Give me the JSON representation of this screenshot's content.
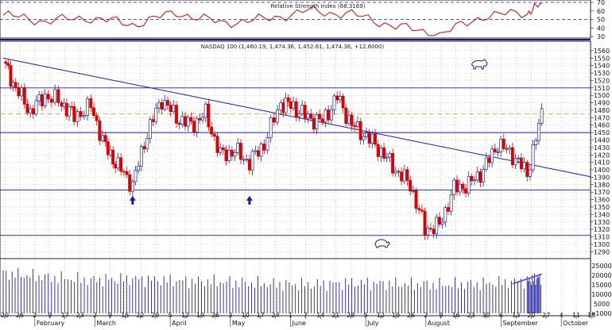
{
  "rsi_panel": {
    "title": "Relative Strength Index (68.3169)",
    "y_ticks": [
      "70",
      "60",
      "50",
      "40",
      "30"
    ]
  },
  "price_panel": {
    "title": "NASDAQ 100 (1,460.19, 1,474.36, 1,452.61, 1,474.36, +12.6000)",
    "y_ticks": [
      "1560",
      "1550",
      "1540",
      "1530",
      "1520",
      "1510",
      "1500",
      "1490",
      "1480",
      "1470",
      "1460",
      "1450",
      "1440",
      "1430",
      "1420",
      "1410",
      "1400",
      "1390",
      "1380",
      "1370",
      "1360",
      "1350",
      "1340",
      "1330",
      "1320",
      "1310",
      "1300",
      "1290"
    ]
  },
  "volume_panel": {
    "y_ticks": [
      "25000",
      "20000",
      "15000",
      "10000",
      "5000",
      "x1000"
    ]
  },
  "x_axis": {
    "day_ticks": [
      "20",
      "26",
      "2",
      "9",
      "17",
      "23",
      "2",
      "9",
      "15",
      "22",
      "29",
      "5",
      "12",
      "19",
      "26",
      "3",
      "10",
      "17",
      "24",
      "1",
      "7",
      "14",
      "21",
      "28",
      "5",
      "12",
      "19",
      "26",
      "2",
      "9",
      "16",
      "23",
      "30",
      "6",
      "13",
      "20",
      "27",
      "4",
      "11",
      "18"
    ],
    "month_labels": [
      "February",
      "March",
      "April",
      "May",
      "June",
      "July",
      "August",
      "September",
      "October"
    ]
  },
  "colors": {
    "up": "#1f2a8c",
    "down": "#e00000",
    "rsi_line": "#d80000",
    "trend_line": "#1a1aa8",
    "support_line": "#1a1aa8",
    "reference_dashed": "#f0a050",
    "volume": "#20209a",
    "grid": "#7a7a7a"
  },
  "icons": [
    "bull-icon",
    "bear-icon",
    "up-arrow-icon"
  ],
  "chart_data": [
    {
      "type": "line",
      "name": "Relative Strength Index",
      "ylim": [
        30,
        70
      ],
      "reference_levels": [
        50,
        70
      ],
      "last_value": 68.3169,
      "x": [
        "Jan 20",
        "Feb 9",
        "Mar 2",
        "Mar 22",
        "Apr 12",
        "May 3",
        "May 24",
        "Jun 14",
        "Jul 5",
        "Jul 26",
        "Aug 16",
        "Sep 6",
        "Sep 27",
        "Oct 4"
      ],
      "values": [
        55,
        48,
        52,
        44,
        58,
        46,
        50,
        60,
        56,
        42,
        32,
        54,
        58,
        68
      ]
    },
    {
      "type": "candlestick",
      "name": "NASDAQ 100",
      "ylim": [
        1285,
        1562
      ],
      "last": {
        "open": 1460.19,
        "high": 1474.36,
        "low": 1452.61,
        "close": 1474.36,
        "change": 12.6
      },
      "x": [
        "Jan 20",
        "Jan 26",
        "Feb 2",
        "Feb 9",
        "Feb 17",
        "Feb 23",
        "Mar 2",
        "Mar 9",
        "Mar 15",
        "Mar 22",
        "Mar 29",
        "Apr 5",
        "Apr 12",
        "Apr 19",
        "Apr 26",
        "May 3",
        "May 10",
        "May 17",
        "May 24",
        "Jun 1",
        "Jun 7",
        "Jun 14",
        "Jun 21",
        "Jun 28",
        "Jul 5",
        "Jul 12",
        "Jul 19",
        "Jul 26",
        "Aug 2",
        "Aug 9",
        "Aug 16",
        "Aug 23",
        "Aug 30",
        "Sep 6",
        "Sep 13",
        "Sep 20",
        "Sep 27",
        "Oct 4"
      ],
      "close": [
        1545,
        1510,
        1478,
        1500,
        1490,
        1472,
        1485,
        1430,
        1405,
        1380,
        1450,
        1495,
        1470,
        1460,
        1475,
        1420,
        1425,
        1410,
        1435,
        1490,
        1485,
        1470,
        1465,
        1498,
        1460,
        1445,
        1425,
        1400,
        1380,
        1320,
        1325,
        1375,
        1380,
        1400,
        1435,
        1420,
        1395,
        1474
      ],
      "trendline": {
        "from": {
          "x": "Jan 20",
          "y": 1550
        },
        "to": {
          "x": "Oct 11",
          "y": 1400
        }
      },
      "support_levels": [
        1510,
        1450,
        1373,
        1312
      ],
      "reference_dashed": [
        1475
      ],
      "arrows_at": [
        "Mar 22",
        "May 17"
      ]
    },
    {
      "type": "bar",
      "name": "Volume",
      "unit": "x1000",
      "ylim": [
        0,
        27000
      ],
      "x": [
        "Jan 20",
        "Feb 9",
        "Mar 2",
        "Mar 22",
        "Apr 12",
        "May 3",
        "May 24",
        "Jun 14",
        "Jul 5",
        "Jul 26",
        "Aug 16",
        "Sep 6",
        "Sep 27",
        "Oct 4"
      ],
      "values": [
        21000,
        19000,
        17500,
        18000,
        17000,
        16500,
        15500,
        15000,
        16000,
        15500,
        15000,
        15500,
        17000,
        19000
      ]
    }
  ]
}
